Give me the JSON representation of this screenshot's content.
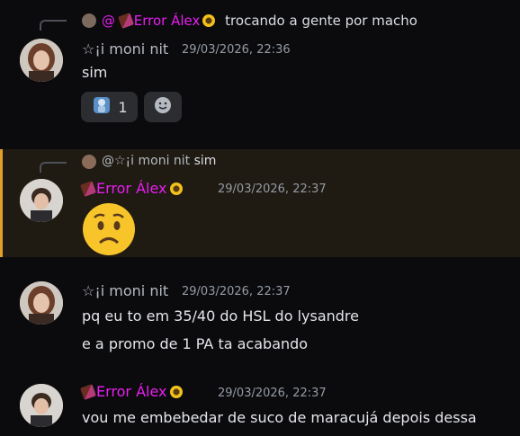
{
  "messages": [
    {
      "reply": {
        "mention": "@",
        "author": "Error Álex",
        "text": "trocando a gente por macho"
      },
      "author": "☆¡i moni nit",
      "timestamp": "29/03/2026, 22:36",
      "lines": [
        "sim"
      ],
      "reactions": [
        {
          "emoji": "figure-emoji",
          "count": "1"
        }
      ]
    },
    {
      "reply": {
        "mention": "@☆¡i moni nit",
        "text": "sim"
      },
      "author": "Error Álex",
      "timestamp": "29/03/2026, 22:37",
      "emoji": "worried-face"
    },
    {
      "author": "☆¡i moni nit",
      "timestamp": "29/03/2026, 22:37",
      "lines": [
        "pq eu to em 35/40 do HSL do lysandre",
        "e a promo de 1 PA ta acabando"
      ]
    },
    {
      "author": "Error Álex",
      "timestamp": "29/03/2026, 22:37",
      "lines": [
        "vou me embebedar de suco de maracujá depois dessa"
      ]
    }
  ],
  "colors": {
    "background": "#0b0b0e",
    "highlight_bg": "#1f1a12",
    "highlight_border": "#e2a02b",
    "alex_name": "#e91ef0",
    "moni_name": "#b5bac1",
    "timestamp": "#949ba4"
  }
}
